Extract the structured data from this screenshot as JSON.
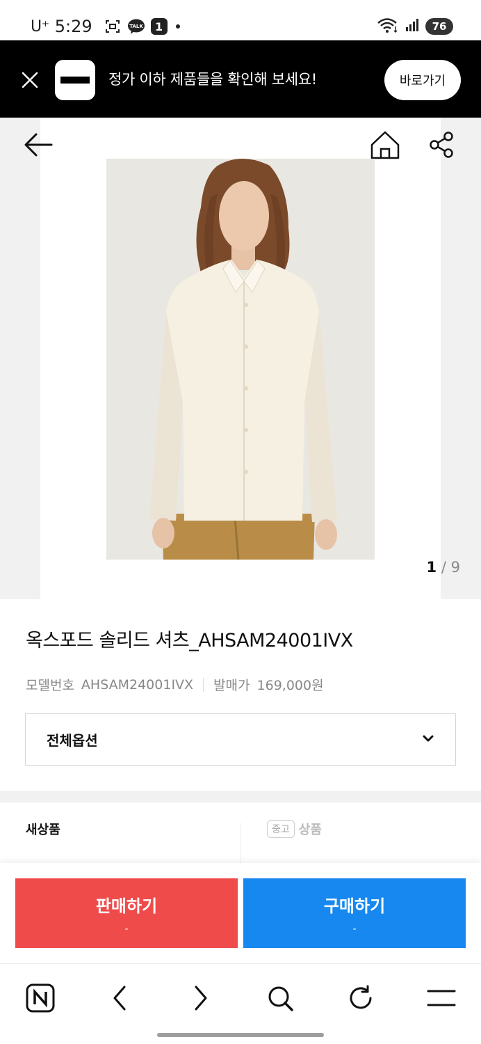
{
  "status_bar": {
    "carrier": "U⁺",
    "time": "5:29",
    "talk_label": "TALK",
    "notification_count": "1",
    "battery": "76"
  },
  "promo": {
    "text": "정가 이하 제품들을 확인해 보세요!",
    "button_label": "바로가기"
  },
  "gallery": {
    "current": "1",
    "separator": "/",
    "total": "9"
  },
  "product": {
    "title": "옥스포드 솔리드 셔츠_AHSAM24001IVX",
    "model_label": "모델번호",
    "model_value": "AHSAM24001IVX",
    "price_label": "발매가",
    "price_value": "169,000원"
  },
  "option": {
    "label": "전체옵션"
  },
  "conditions": {
    "new_label": "새상품",
    "used_badge": "중고",
    "used_label": "상품"
  },
  "actions": {
    "sell_label": "판매하기",
    "sell_sub": "-",
    "buy_label": "구매하기",
    "buy_sub": "-"
  },
  "browser_nav": {
    "icons": [
      "naver-n-icon",
      "back-icon",
      "forward-icon",
      "search-icon",
      "refresh-icon",
      "menu-icon"
    ]
  },
  "colors": {
    "sell": "#ef4b4b",
    "buy": "#1688f0",
    "banner": "#000000"
  }
}
